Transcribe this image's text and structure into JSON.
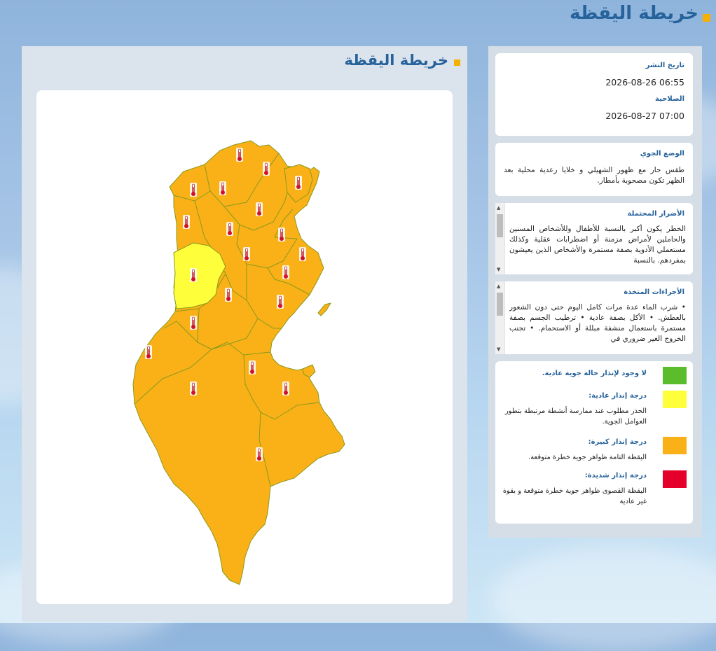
{
  "page": {
    "title": "خريطة اليقظة"
  },
  "map": {
    "title": "خريطة اليقظة",
    "regions_level": {
      "default": "orange",
      "highlighted": "yellow"
    }
  },
  "publication": {
    "published_label": "تاريخ النشر",
    "published_value": "2026-08-26 06:55",
    "validity_label": "الصلاحية",
    "validity_value": "2026-08-27 07:00"
  },
  "weather": {
    "label": "الوضع الجوي",
    "text": "طقس حار مع ظهور الشهيلي و خلايا رعدية محلية بعد الظهر تكون مصحوبة بأمطار."
  },
  "damages": {
    "label": "الأضرار المحتملة",
    "text": "الخطر يكون أكبر بالنسبة للأطفال وللأشخاص المسنين والحاملين لأمراض مزمنة أو اضطرابات عقلية وكذلك مستعملي الأدوية بصفة مستمرة والأشخاص الذين يعيشون بمفردهم. بالنسبة"
  },
  "measures": {
    "label": "الأجراءات المتخذة",
    "text": "• شرب الماء عدة مرات كامل اليوم حتى دون الشعور بالعطش. • الأكل بصفة عادية • ترطيب الجسم بصفة مستمرة باستعمال منشفة مبللة أو الاستحمام. • تجنب الخروج الغير ضروري في"
  },
  "legend": {
    "green_title": "لا وجود لإنذار حالة جوية عادية.",
    "yellow_title": "درجة إنذار عادية:",
    "yellow_desc": "الحذر مطلوب عند ممارسة أنشطة مرتبطة بتطور العوامل الجوية.",
    "orange_title": "درجة إنذار كبيرة:",
    "orange_desc": "اليقظة التامة ظواهر جوية خطرة متوقعة.",
    "red_title": "درجة إنذار شديدة:",
    "red_desc": "اليقظة القصوى ظواهر جوية خطرة متوقعة و بقوة غير عادية"
  },
  "colors": {
    "green": "#5cbd2c",
    "yellow": "#fefe3a",
    "orange": "#f9b117",
    "red": "#e5002b",
    "accent": "#f5b000",
    "title": "#26629b"
  },
  "icons": {
    "map_marker": "thermometer-icon"
  }
}
